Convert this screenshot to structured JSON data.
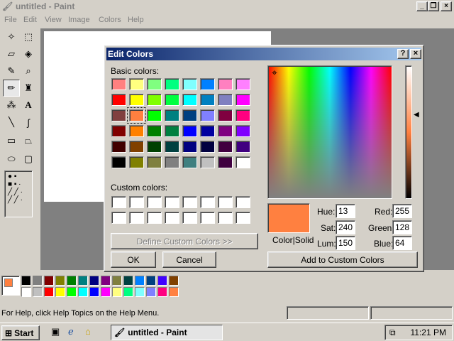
{
  "window": {
    "title": "untitled - Paint"
  },
  "menu": [
    "File",
    "Edit",
    "View",
    "Image",
    "Colors",
    "Help"
  ],
  "palette_colors": [
    "#000000",
    "#808080",
    "#800000",
    "#808000",
    "#008000",
    "#008080",
    "#000080",
    "#800080",
    "#808040",
    "#004040",
    "#0080ff",
    "#004080",
    "#4000ff",
    "#804000",
    "#ffffff",
    "#c0c0c0",
    "#ff0000",
    "#ffff00",
    "#00ff00",
    "#00ffff",
    "#0000ff",
    "#ff00ff",
    "#ffff80",
    "#00ff80",
    "#80ffff",
    "#8080ff",
    "#ff0080",
    "#ff8040"
  ],
  "status": {
    "help_text": "For Help, click Help Topics on the Help Menu."
  },
  "taskbar": {
    "start_label": "Start",
    "task_label": "untitled - Paint",
    "clock": "11:21 PM"
  },
  "dialog": {
    "title": "Edit Colors",
    "basic_label": "Basic colors:",
    "basic_colors": [
      "#ff8080",
      "#ffff80",
      "#80ff80",
      "#00ff80",
      "#80ffff",
      "#0080ff",
      "#ff80c0",
      "#ff80ff",
      "#ff0000",
      "#ffff00",
      "#80ff00",
      "#00ff40",
      "#00ffff",
      "#0080c0",
      "#8080c0",
      "#ff00ff",
      "#804040",
      "#ff8040",
      "#00ff00",
      "#008080",
      "#004080",
      "#8080ff",
      "#800040",
      "#ff0080",
      "#800000",
      "#ff8000",
      "#008000",
      "#008040",
      "#0000ff",
      "#0000a0",
      "#800080",
      "#8000ff",
      "#400000",
      "#804000",
      "#004000",
      "#004040",
      "#000080",
      "#000040",
      "#400040",
      "#400080",
      "#000000",
      "#808000",
      "#808040",
      "#808080",
      "#408080",
      "#c0c0c0",
      "#400040",
      "#ffffff"
    ],
    "selected_basic_index": 17,
    "custom_label": "Custom colors:",
    "define_button": "Define Custom Colors >>",
    "ok_button": "OK",
    "cancel_button": "Cancel",
    "color_solid_label": "Color|Solid",
    "preview_color": "#ff8040",
    "hue_label": "Hue:",
    "hue": "13",
    "sat_label": "Sat:",
    "sat": "240",
    "lum_label": "Lum:",
    "lum": "150",
    "red_label": "Red:",
    "red": "255",
    "green_label": "Green:",
    "green": "128",
    "blue_label": "Blue:",
    "blue": "64",
    "add_button": "Add to Custom Colors"
  }
}
